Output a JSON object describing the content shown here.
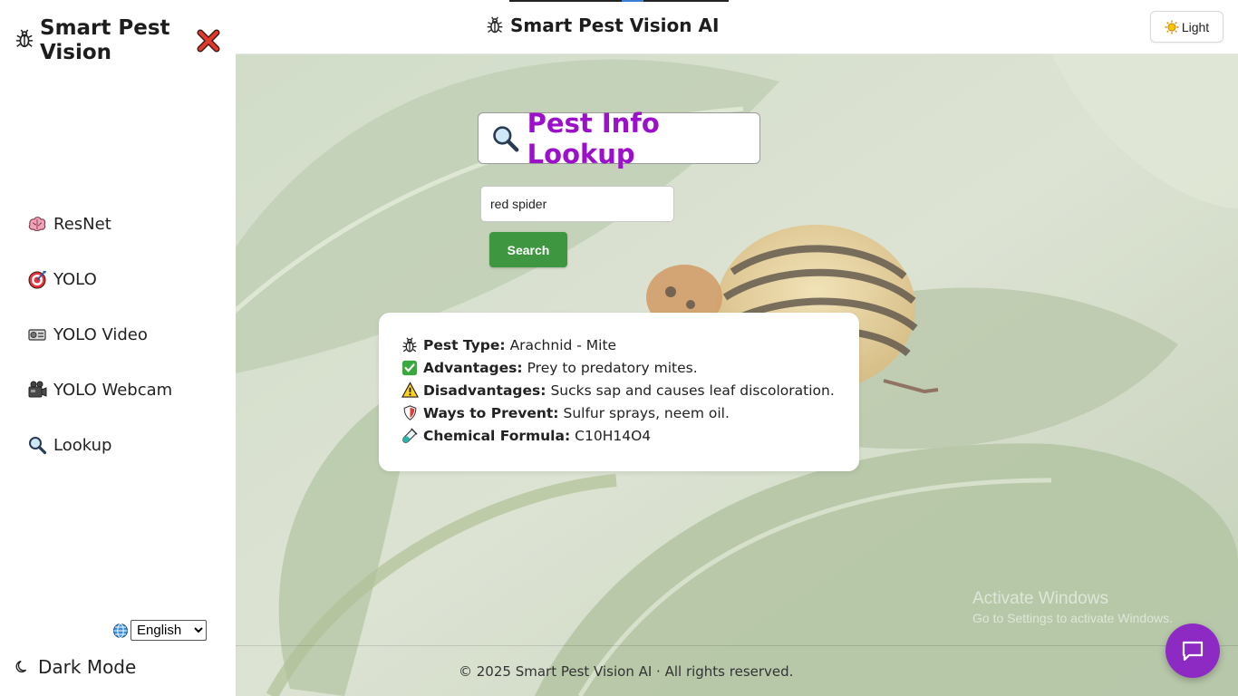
{
  "sidebar": {
    "brand_title": "Smart Pest Vision",
    "items": [
      {
        "label": "ResNet",
        "icon": "brain-icon"
      },
      {
        "label": "YOLO",
        "icon": "target-icon"
      },
      {
        "label": "YOLO Video",
        "icon": "video-projector-icon"
      },
      {
        "label": "YOLO Webcam",
        "icon": "video-camera-icon"
      },
      {
        "label": "Lookup",
        "icon": "magnifier-icon"
      }
    ],
    "language": {
      "selected": "English",
      "icon": "globe-icon"
    },
    "dark_mode_label": "Dark Mode"
  },
  "topbar": {
    "title": "Smart Pest Vision AI",
    "theme_button_label": "Light"
  },
  "lookup": {
    "title": "Pest Info Lookup",
    "search_value": "red spider",
    "search_button_label": "Search"
  },
  "result": {
    "rows": [
      {
        "icon": "bug-icon",
        "label": "Pest Type:",
        "value": "Arachnid - Mite"
      },
      {
        "icon": "check-mark-icon",
        "label": "Advantages:",
        "value": "Prey to predatory mites."
      },
      {
        "icon": "warning-icon",
        "label": "Disadvantages:",
        "value": "Sucks sap and causes leaf discoloration."
      },
      {
        "icon": "shield-icon",
        "label": "Ways to Prevent:",
        "value": "Sulfur sprays, neem oil."
      },
      {
        "icon": "test-tube-icon",
        "label": "Chemical Formula:",
        "value": "C10H14O4"
      }
    ]
  },
  "watermark": {
    "line1": "Activate Windows",
    "line2": "Go to Settings to activate Windows."
  },
  "footer": {
    "text": "© 2025 Smart Pest Vision AI · All rights reserved."
  },
  "colors": {
    "accent_purple": "#9b10c9",
    "search_green": "#3f9640",
    "chat_purple": "#8e2ac4",
    "close_red": "#e0382b"
  }
}
